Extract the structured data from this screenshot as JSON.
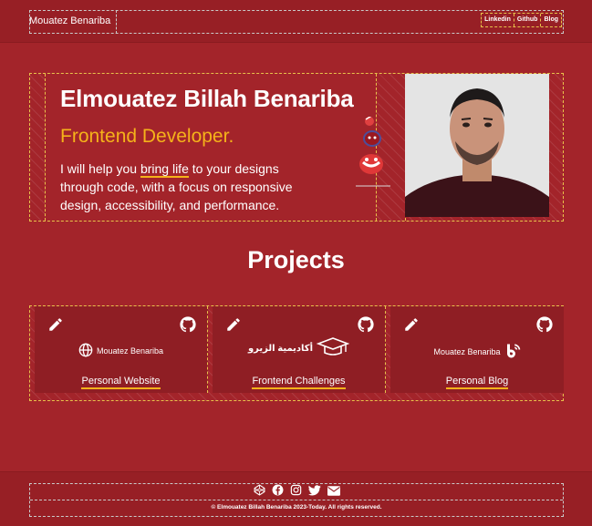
{
  "header": {
    "brand": "Mouatez Benariba",
    "nav": [
      "Linkedin",
      "Github",
      "Blog"
    ]
  },
  "hero": {
    "name": "Elmouatez Billah Benariba",
    "role": "Frontend Developer.",
    "desc_pre": "I will help you ",
    "desc_highlight": "bring life",
    "desc_post": " to your designs through code, with a focus on responsive design, accessibility, and performance."
  },
  "projects": {
    "title": "Projects",
    "items": [
      {
        "logo_text": "Mouatez Benariba",
        "logo_icon": "globe-icon",
        "link": "Personal Website"
      },
      {
        "logo_text": "أكاديمية الزيرو",
        "logo_icon": "graduation-cap-icon",
        "link": "Frontend Challenges"
      },
      {
        "logo_text": "Mouatez Benariba",
        "logo_icon": "blog-icon",
        "link": "Personal Blog"
      }
    ]
  },
  "footer": {
    "icons": [
      "codepen-icon",
      "facebook-icon",
      "instagram-icon",
      "twitter-icon",
      "mail-icon"
    ],
    "copyright": "© Elmouatez Billah Benariba 2023-Today. All rights reserved."
  },
  "colors": {
    "background": "#a3242a",
    "accent": "#f5b21a",
    "card": "#8f1e24"
  }
}
